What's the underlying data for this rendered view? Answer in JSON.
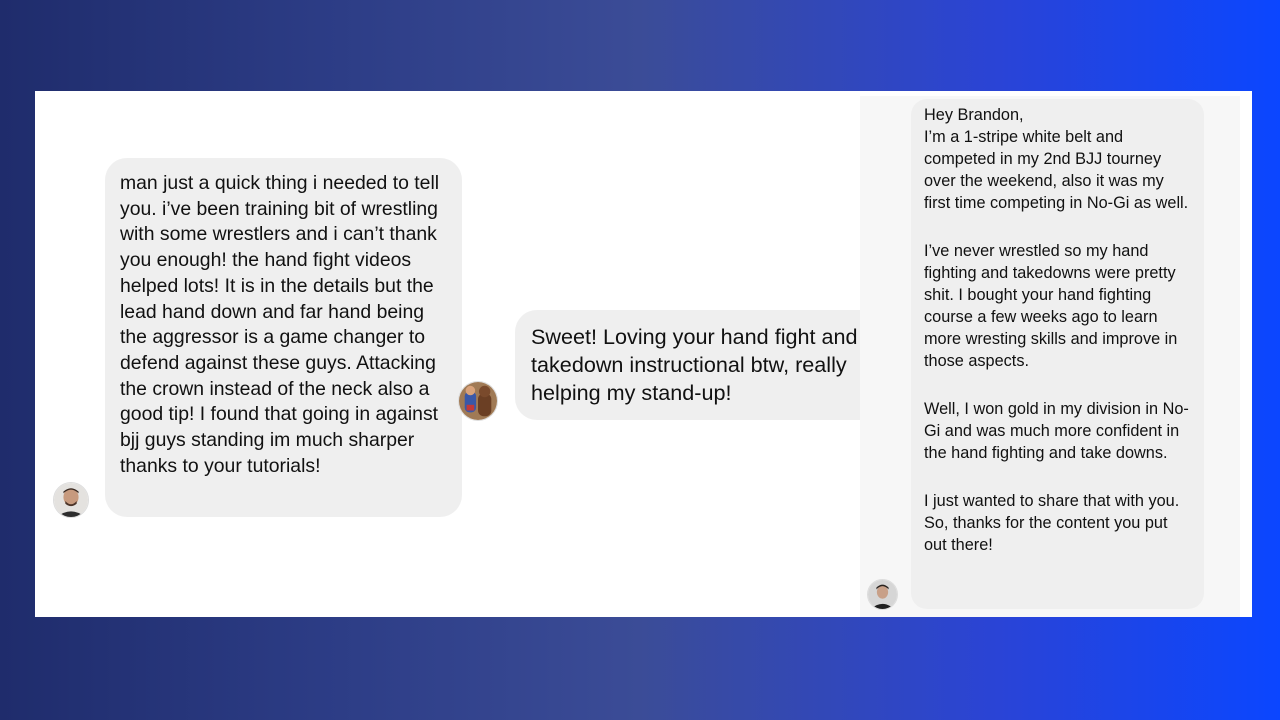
{
  "messages": [
    {
      "text": "man just a quick thing i needed to tell you. i’ve been training bit of wrestling with some wrestlers and i can’t thank you enough! the hand fight videos helped lots! It is in the details but the lead hand down and far hand being the aggressor is a game changer to defend against these guys. Attacking the crown instead of the neck also a good tip! I found that going in against bjj guys standing im much sharper thanks to your tutorials!"
    },
    {
      "text": "Sweet! Loving your hand fight and takedown instructional btw, really helping my stand-up!"
    },
    {
      "paragraphs": [
        "Hey Brandon,\nI’m a 1-stripe white belt and competed in my 2nd BJJ tourney over the weekend, also it was my first time competing in No-Gi as well.",
        "I’ve never wrestled so my hand fighting and takedowns were pretty shit. I bought your hand fighting course a few weeks ago to learn more wresting skills and improve in those aspects.",
        "Well, I won gold in my division in No-Gi and was much more confident in the hand fighting and take downs.",
        "I just wanted to share that with you. So, thanks for the content you put out there!"
      ]
    }
  ],
  "colors": {
    "bubble": "#efefef",
    "text": "#111111",
    "panel": "#ffffff"
  }
}
